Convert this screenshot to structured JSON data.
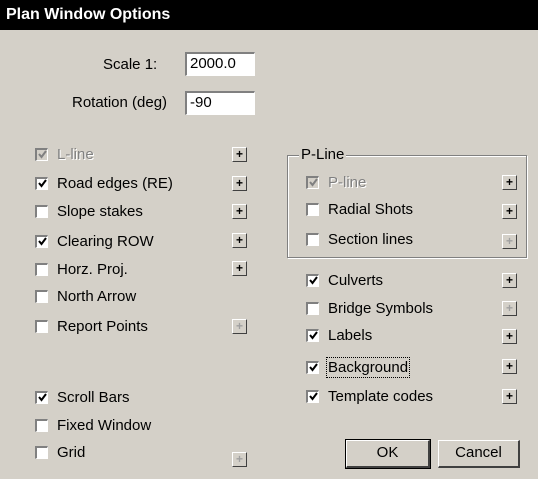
{
  "window": {
    "title": "Plan Window Options"
  },
  "scale": {
    "label": "Scale  1:",
    "value": "2000.0"
  },
  "rotation": {
    "label": "Rotation (deg)",
    "value": "-90"
  },
  "left_options": [
    {
      "label": "L-line",
      "checked": true,
      "disabled": true,
      "plus_disabled": false
    },
    {
      "label": "Road edges (RE)",
      "checked": true,
      "disabled": false,
      "plus_disabled": false
    },
    {
      "label": "Slope stakes",
      "checked": false,
      "disabled": false,
      "plus_disabled": false
    },
    {
      "label": "Clearing ROW",
      "checked": true,
      "disabled": false,
      "plus_disabled": false
    },
    {
      "label": "Horz. Proj.",
      "checked": false,
      "disabled": false,
      "plus_disabled": false
    },
    {
      "label": "North Arrow",
      "checked": false,
      "disabled": false,
      "has_plus": false
    },
    {
      "label": "Report Points",
      "checked": false,
      "disabled": false,
      "plus_disabled": true
    }
  ],
  "bottom_left_options": [
    {
      "label": "Scroll Bars",
      "checked": true
    },
    {
      "label": "Fixed Window",
      "checked": false
    },
    {
      "label": "Grid",
      "checked": false,
      "plus_disabled": true
    }
  ],
  "pline_group": {
    "title": "P-Line",
    "options": [
      {
        "label": "P-line",
        "checked": true,
        "disabled": true,
        "plus_disabled": false
      },
      {
        "label": "Radial Shots",
        "checked": false,
        "disabled": false,
        "plus_disabled": false
      },
      {
        "label": "Section lines",
        "checked": false,
        "disabled": false,
        "plus_disabled": true
      }
    ]
  },
  "right_options": [
    {
      "label": "Culverts",
      "checked": true,
      "plus_disabled": false
    },
    {
      "label": "Bridge Symbols",
      "checked": false,
      "plus_disabled": true
    },
    {
      "label": "Labels",
      "checked": true,
      "plus_disabled": false
    },
    {
      "label": "Background",
      "checked": true,
      "plus_disabled": false,
      "focused": true
    },
    {
      "label": "Template codes",
      "checked": true,
      "plus_disabled": false
    }
  ],
  "plus_symbol": "+",
  "buttons": {
    "ok": "OK",
    "cancel": "Cancel"
  }
}
